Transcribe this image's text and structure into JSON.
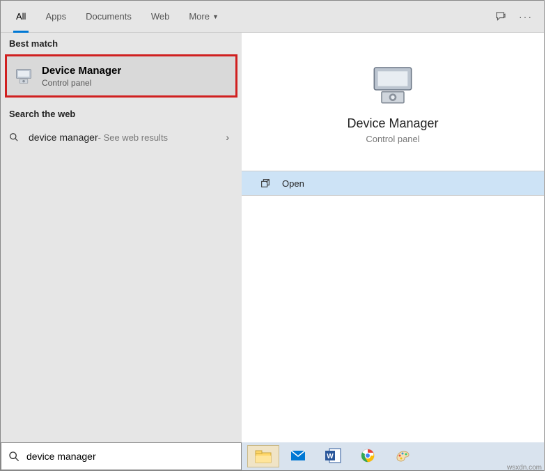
{
  "tabs": {
    "all": "All",
    "apps": "Apps",
    "documents": "Documents",
    "web": "Web",
    "more": "More"
  },
  "sections": {
    "best_match": "Best match",
    "search_web": "Search the web"
  },
  "best_match": {
    "title": "Device Manager",
    "subtitle": "Control panel"
  },
  "web_result": {
    "query": "device manager",
    "hint": " - See web results"
  },
  "preview": {
    "title": "Device Manager",
    "subtitle": "Control panel",
    "open_label": "Open"
  },
  "search": {
    "value": "device manager"
  },
  "watermark": "wsxdn.com"
}
